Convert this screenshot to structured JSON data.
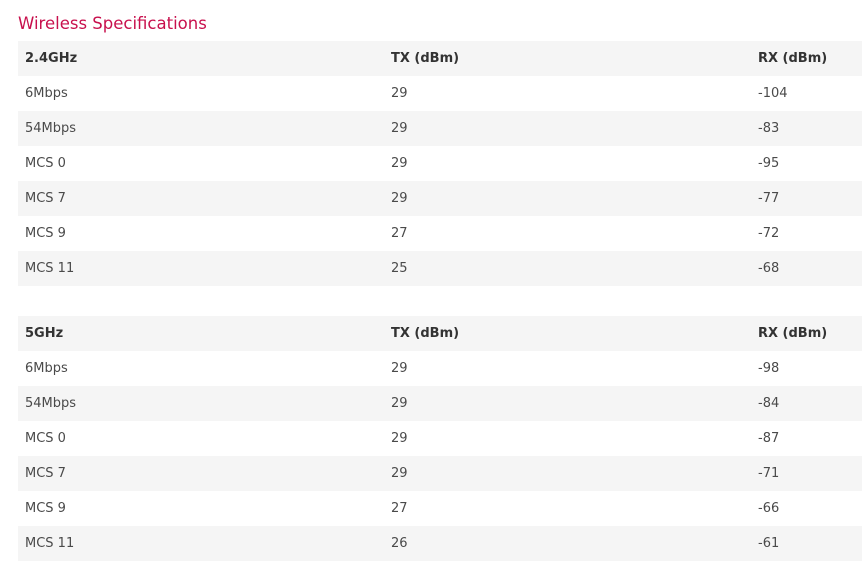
{
  "title": "Wireless Specifications",
  "tables": [
    {
      "headers": [
        "2.4GHz",
        "TX (dBm)",
        "RX (dBm)"
      ],
      "rows": [
        [
          "6Mbps",
          "29",
          "-104"
        ],
        [
          "54Mbps",
          "29",
          "-83"
        ],
        [
          "MCS 0",
          "29",
          "-95"
        ],
        [
          "MCS 7",
          "29",
          "-77"
        ],
        [
          "MCS 9",
          "27",
          "-72"
        ],
        [
          "MCS 11",
          "25",
          "-68"
        ]
      ]
    },
    {
      "headers": [
        "5GHz",
        "TX (dBm)",
        "RX (dBm)"
      ],
      "rows": [
        [
          "6Mbps",
          "29",
          "-98"
        ],
        [
          "54Mbps",
          "29",
          "-84"
        ],
        [
          "MCS 0",
          "29",
          "-87"
        ],
        [
          "MCS 7",
          "29",
          "-71"
        ],
        [
          "MCS 9",
          "27",
          "-66"
        ],
        [
          "MCS 11",
          "26",
          "-61"
        ]
      ]
    }
  ],
  "colors": {
    "title": "#c8104d",
    "row_shade": "#f5f5f5",
    "text": "#333333"
  }
}
